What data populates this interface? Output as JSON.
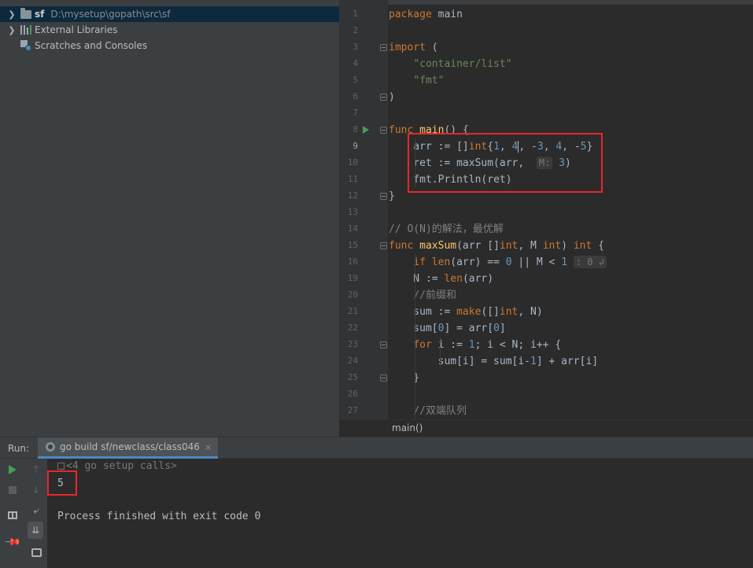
{
  "project_tree": {
    "items": [
      {
        "name": "sf",
        "path": "D:\\mysetup\\gopath\\src\\sf",
        "icon": "folder-icon",
        "expandable": true,
        "selected": true
      },
      {
        "name": "External Libraries",
        "icon": "library-icon",
        "expandable": true,
        "selected": false
      },
      {
        "name": "Scratches and Consoles",
        "icon": "scratches-icon",
        "expandable": false,
        "selected": false
      }
    ]
  },
  "editor": {
    "line_numbers": [
      "1",
      "2",
      "3",
      "4",
      "5",
      "6",
      "7",
      "8",
      "9",
      "10",
      "11",
      "12",
      "13",
      "14",
      "15",
      "16",
      "19",
      "20",
      "21",
      "22",
      "23",
      "24",
      "25",
      "26",
      "27"
    ],
    "current_line": "9",
    "code_lines": [
      "package main",
      "",
      "import (",
      "    \"container/list\"",
      "    \"fmt\"",
      ")",
      "",
      "func main() {",
      "    arr := []int{1, 4, -3, 4, -5}",
      "    ret := maxSum(arr,  M: 3)",
      "    fmt.Println(ret)",
      "}",
      "",
      "// O(N)的解法，最优解",
      "func maxSum(arr []int, M int) int {",
      "    if len(arr) == 0 || M < 1 : 0 ↲",
      "    N := len(arr)",
      "    //前缀和",
      "    sum := make([]int, N)",
      "    sum[0] = arr[0]",
      "    for i := 1; i < N; i++ {",
      "        sum[i] = sum[i-1] + arr[i]",
      "    }",
      "",
      "    //双端队列"
    ],
    "param_hint": "M:",
    "fold_hint": ": 0 ↲",
    "breadcrumb": "main()"
  },
  "run_panel": {
    "label": "Run:",
    "tab_title": "go build sf/newclass/class046",
    "tab_close": "×",
    "setup_calls": "<4 go setup calls>",
    "output": "5",
    "exit_message": "Process finished with exit code 0"
  },
  "colors": {
    "keyword": "#cc7832",
    "string": "#6a8759",
    "number": "#6897bb",
    "function": "#ffc66d",
    "comment": "#808080",
    "highlight_box": "#e8262b",
    "run_green": "#499c54"
  }
}
